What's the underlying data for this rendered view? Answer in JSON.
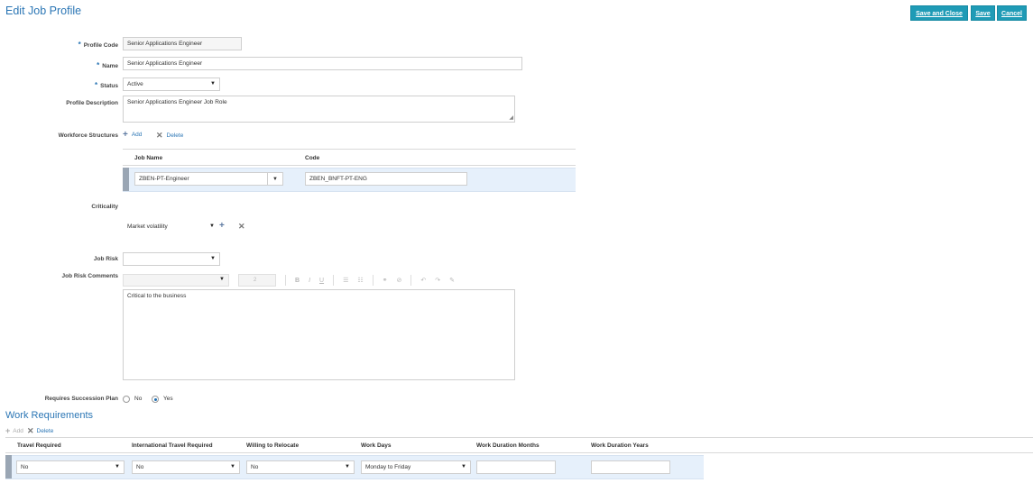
{
  "page": {
    "title": "Edit Job Profile"
  },
  "toolbar": {
    "save_close": "Save and Close",
    "save": "Save",
    "cancel": "Cancel"
  },
  "form": {
    "profile_code": {
      "label": "Profile Code",
      "value": "Senior Applications Engineer",
      "required_mark": "*"
    },
    "name": {
      "label": "Name",
      "value": "Senior Applications Engineer",
      "required_mark": "*"
    },
    "status": {
      "label": "Status",
      "value": "Active",
      "required_mark": "*"
    },
    "profile_description": {
      "label": "Profile Description",
      "value": "Senior Applications Engineer Job Role"
    }
  },
  "workforce": {
    "label": "Workforce Structures",
    "add": "Add",
    "delete": "Delete",
    "columns": [
      "Job Name",
      "Code"
    ],
    "rows": [
      {
        "job_name": "ZBEN-PT-Engineer",
        "code": "ZBEN_BNFT-PT-ENG"
      }
    ]
  },
  "criticality": {
    "label": "Criticality",
    "value": "Market volatility"
  },
  "job_risk": {
    "label": "Job Risk",
    "value": ""
  },
  "job_risk_comments": {
    "label": "Job Risk Comments",
    "font_size": "2",
    "value": "Critical to the business"
  },
  "succession": {
    "label": "Requires Succession Plan",
    "no": "No",
    "yes": "Yes",
    "selected": "Yes"
  },
  "work_requirements": {
    "title": "Work Requirements",
    "add": "Add",
    "delete": "Delete",
    "columns": [
      "Travel Required",
      "International Travel Required",
      "Willing to Relocate",
      "Work Days",
      "Work Duration Months",
      "Work Duration Years"
    ],
    "row": {
      "travel": "No",
      "intl_travel": "No",
      "relocate": "No",
      "work_days": "Monday to Friday",
      "months": "",
      "years": ""
    }
  },
  "colors": {
    "accent": "#2b76b5",
    "button": "#1f9bb6",
    "row_highlight": "#e6f0fb"
  }
}
